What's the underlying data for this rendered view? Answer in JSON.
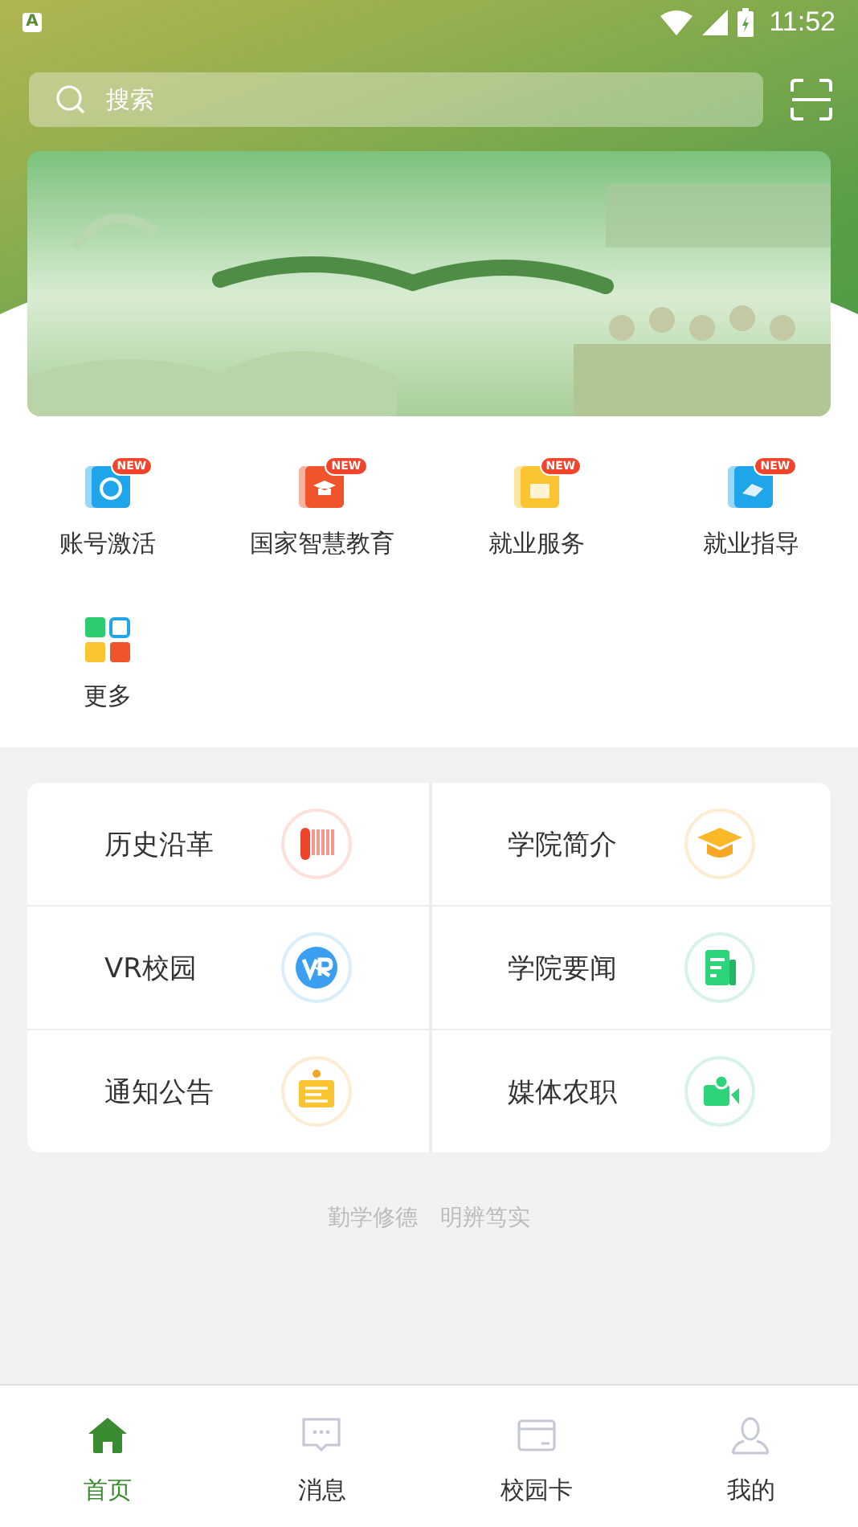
{
  "status_bar": {
    "notification": "A",
    "time": "11:52"
  },
  "search": {
    "placeholder": "搜索"
  },
  "quick_links": [
    {
      "label": "账号激活",
      "kind": "account",
      "badge": "NEW"
    },
    {
      "label": "国家智慧教育",
      "kind": "education",
      "badge": "NEW"
    },
    {
      "label": "就业服务",
      "kind": "employment",
      "badge": "NEW"
    },
    {
      "label": "就业指导",
      "kind": "guide",
      "badge": "NEW"
    },
    {
      "label": "更多",
      "kind": "more"
    }
  ],
  "services": [
    {
      "label": "历史沿革",
      "kind": "history"
    },
    {
      "label": "学院简介",
      "kind": "intro"
    },
    {
      "label": "VR校园",
      "kind": "vr"
    },
    {
      "label": "学院要闻",
      "kind": "news"
    },
    {
      "label": "通知公告",
      "kind": "notice"
    },
    {
      "label": "媒体农职",
      "kind": "media"
    }
  ],
  "motto": "勤学修德　明辨笃实",
  "tabs": [
    {
      "label": "首页",
      "kind": "home",
      "selected": true
    },
    {
      "label": "消息",
      "kind": "message",
      "selected": false
    },
    {
      "label": "校园卡",
      "kind": "card",
      "selected": false
    },
    {
      "label": "我的",
      "kind": "profile",
      "selected": false
    }
  ]
}
